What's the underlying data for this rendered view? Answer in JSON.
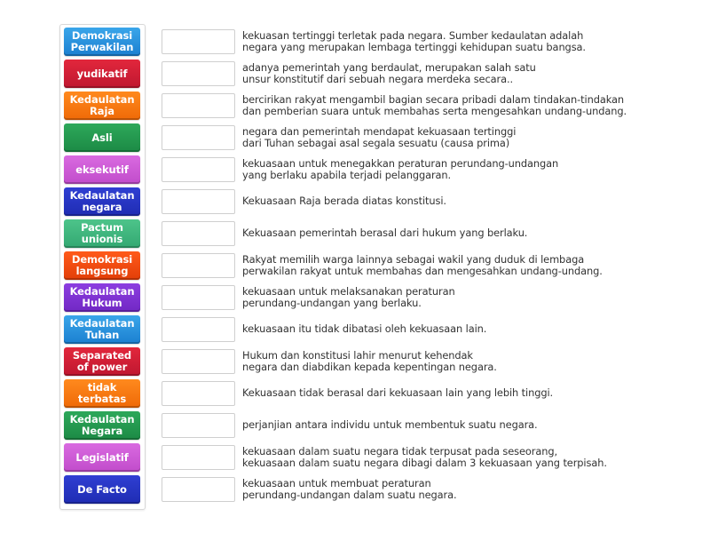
{
  "tiles": [
    {
      "label": "Demokrasi\nPerwakilan",
      "color_top": "#3aa6ea",
      "color_bottom": "#1b7fd0"
    },
    {
      "label": "yudikatif",
      "color_top": "#e2273c",
      "color_bottom": "#bf1730"
    },
    {
      "label": "Kedaulatan\nRaja",
      "color_top": "#ff8a1e",
      "color_bottom": "#ef6a07"
    },
    {
      "label": "Asli",
      "color_top": "#2da85a",
      "color_bottom": "#1c8a45"
    },
    {
      "label": "eksekutif",
      "color_top": "#d96ae0",
      "color_bottom": "#c14ccb"
    },
    {
      "label": "Kedaulatan\nnegara",
      "color_top": "#2f3fd3",
      "color_bottom": "#1f2cb3"
    },
    {
      "label": "Pactum\nunionis",
      "color_top": "#4dc48a",
      "color_bottom": "#33a872"
    },
    {
      "label": "Demokrasi\nlangsung",
      "color_top": "#ff5a1a",
      "color_bottom": "#e23e08"
    },
    {
      "label": "Kedaulatan\nHukum",
      "color_top": "#8c3ee0",
      "color_bottom": "#7128c4"
    },
    {
      "label": "Kedaulatan\nTuhan",
      "color_top": "#3aa6ea",
      "color_bottom": "#1b7fd0"
    },
    {
      "label": "Separated\nof power",
      "color_top": "#e2273c",
      "color_bottom": "#bf1730"
    },
    {
      "label": "tidak\nterbatas",
      "color_top": "#ff8a1e",
      "color_bottom": "#ef6a07"
    },
    {
      "label": "Kedaulatan\nNegara",
      "color_top": "#2da85a",
      "color_bottom": "#1c8a45"
    },
    {
      "label": "Legislatif",
      "color_top": "#d96ae0",
      "color_bottom": "#c14ccb"
    },
    {
      "label": "De Facto",
      "color_top": "#2f3fd3",
      "color_bottom": "#1f2cb3"
    }
  ],
  "rows": [
    {
      "answer": "",
      "description": "kekuasan tertinggi terletak pada negara. Sumber kedaulatan adalah\nnegara yang merupakan lembaga tertinggi kehidupan suatu bangsa."
    },
    {
      "answer": "",
      "description": "adanya pemerintah yang berdaulat, merupakan salah satu\nunsur konstitutif dari sebuah negara merdeka secara.."
    },
    {
      "answer": "",
      "description": "bercirikan rakyat mengambil bagian secara pribadi dalam tindakan-tindakan\ndan pemberian suara untuk membahas serta mengesahkan undang-undang."
    },
    {
      "answer": "",
      "description": "negara dan pemerintah mendapat kekuasaan tertinggi\ndari Tuhan sebagai asal segala sesuatu (causa prima)"
    },
    {
      "answer": "",
      "description": "kekuasaan untuk menegakkan peraturan perundang-undangan\nyang berlaku apabila terjadi pelanggaran."
    },
    {
      "answer": "",
      "description": "Kekuasaan Raja berada diatas konstitusi."
    },
    {
      "answer": "",
      "description": "Kekuasaan pemerintah berasal dari hukum yang berlaku."
    },
    {
      "answer": "",
      "description": "Rakyat memilih warga lainnya sebagai wakil yang duduk di lembaga\nperwakilan rakyat untuk membahas dan mengesahkan undang-undang."
    },
    {
      "answer": "",
      "description": "kekuasaan untuk melaksanakan peraturan\nperundang-undangan yang berlaku."
    },
    {
      "answer": "",
      "description": "kekuasaan itu tidak dibatasi oleh kekuasaan lain."
    },
    {
      "answer": "",
      "description": "Hukum dan konstitusi lahir menurut kehendak\nnegara dan diabdikan kepada kepentingan negara."
    },
    {
      "answer": "",
      "description": "Kekuasaan tidak berasal dari kekuasaan lain yang lebih tinggi."
    },
    {
      "answer": "",
      "description": "perjanjian antara individu untuk membentuk suatu negara."
    },
    {
      "answer": "",
      "description": "kekuasaan dalam suatu negara tidak terpusat pada seseorang,\nkekuasaan dalam suatu negara dibagi dalam 3 kekuasaan yang terpisah."
    },
    {
      "answer": "",
      "description": "kekuasaan untuk membuat peraturan\nperundang-undangan dalam suatu negara."
    }
  ]
}
